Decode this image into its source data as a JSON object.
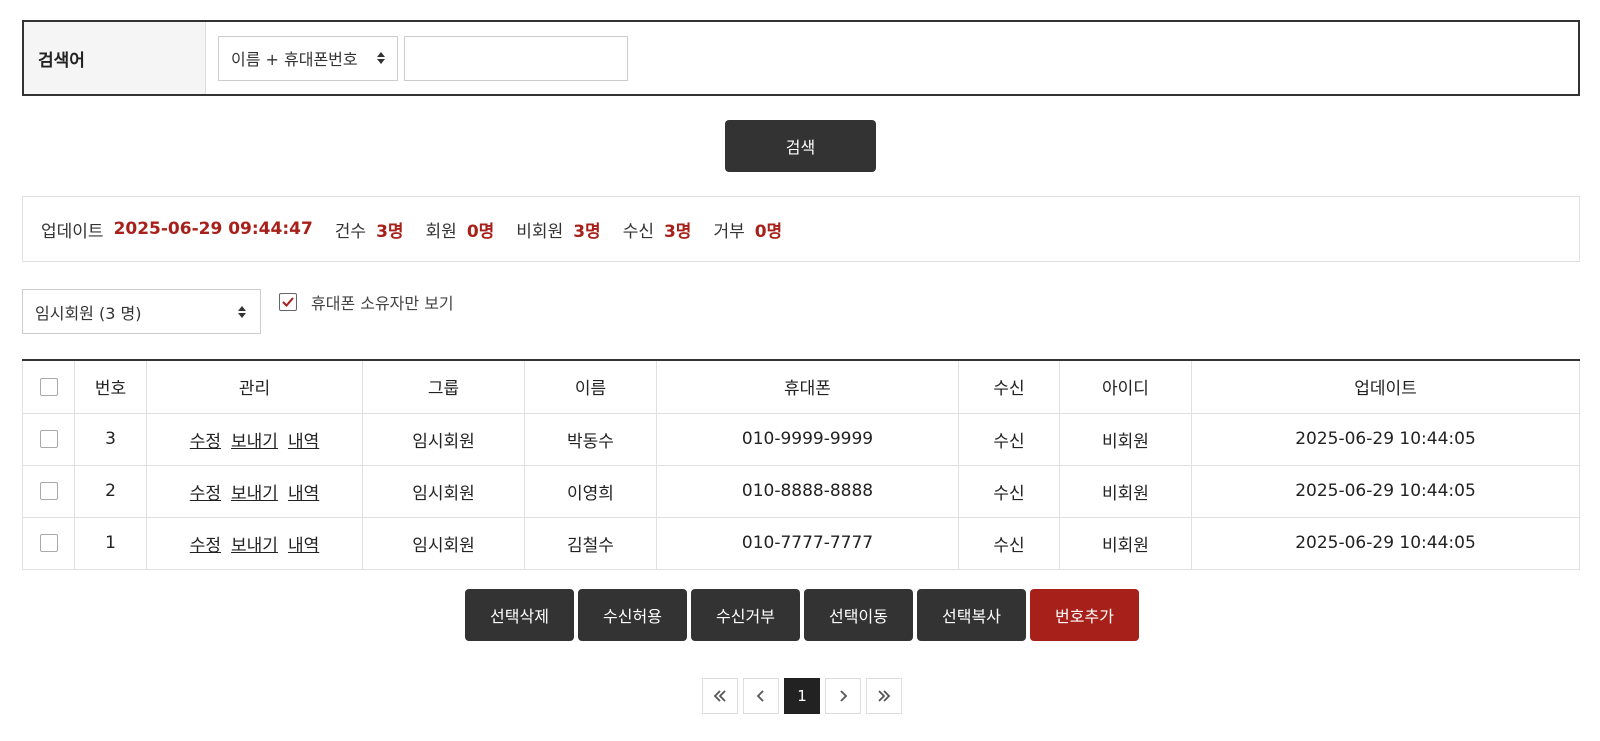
{
  "search": {
    "label": "검색어",
    "field_select": "이름 + 휴대폰번호",
    "input_value": "",
    "button_label": "검색"
  },
  "stats": {
    "updated_label": "업데이트",
    "updated_value": "2025-06-29 09:44:47",
    "count_label": "건수",
    "count_value": "3명",
    "member_label": "회원",
    "member_value": "0명",
    "nonmember_label": "비회원",
    "nonmember_value": "3명",
    "receive_label": "수신",
    "receive_value": "3명",
    "reject_label": "거부",
    "reject_value": "0명"
  },
  "filters": {
    "group_select": "임시회원 (3 명)",
    "owner_only_label": "휴대폰 소유자만 보기",
    "owner_only_checked": true
  },
  "table": {
    "headers": {
      "number": "번호",
      "manage": "관리",
      "group": "그룹",
      "name": "이름",
      "phone": "휴대폰",
      "receive": "수신",
      "userid": "아이디",
      "updated": "업데이트"
    },
    "actions": {
      "edit": "수정",
      "send": "보내기",
      "history": "내역"
    },
    "rows": [
      {
        "number": "3",
        "group": "임시회원",
        "name": "박동수",
        "phone": "010-9999-9999",
        "receive": "수신",
        "userid": "비회원",
        "updated": "2025-06-29 10:44:05"
      },
      {
        "number": "2",
        "group": "임시회원",
        "name": "이영희",
        "phone": "010-8888-8888",
        "receive": "수신",
        "userid": "비회원",
        "updated": "2025-06-29 10:44:05"
      },
      {
        "number": "1",
        "group": "임시회원",
        "name": "김철수",
        "phone": "010-7777-7777",
        "receive": "수신",
        "userid": "비회원",
        "updated": "2025-06-29 10:44:05"
      }
    ]
  },
  "bulk_actions": {
    "delete": "선택삭제",
    "allow": "수신허용",
    "reject": "수신거부",
    "move": "선택이동",
    "copy": "선택복사",
    "add": "번호추가"
  },
  "pagination": {
    "current": "1"
  },
  "colors": {
    "accent_red": "#a8201a",
    "dark_button": "#333333",
    "receive_green": "#2e7d5b"
  }
}
